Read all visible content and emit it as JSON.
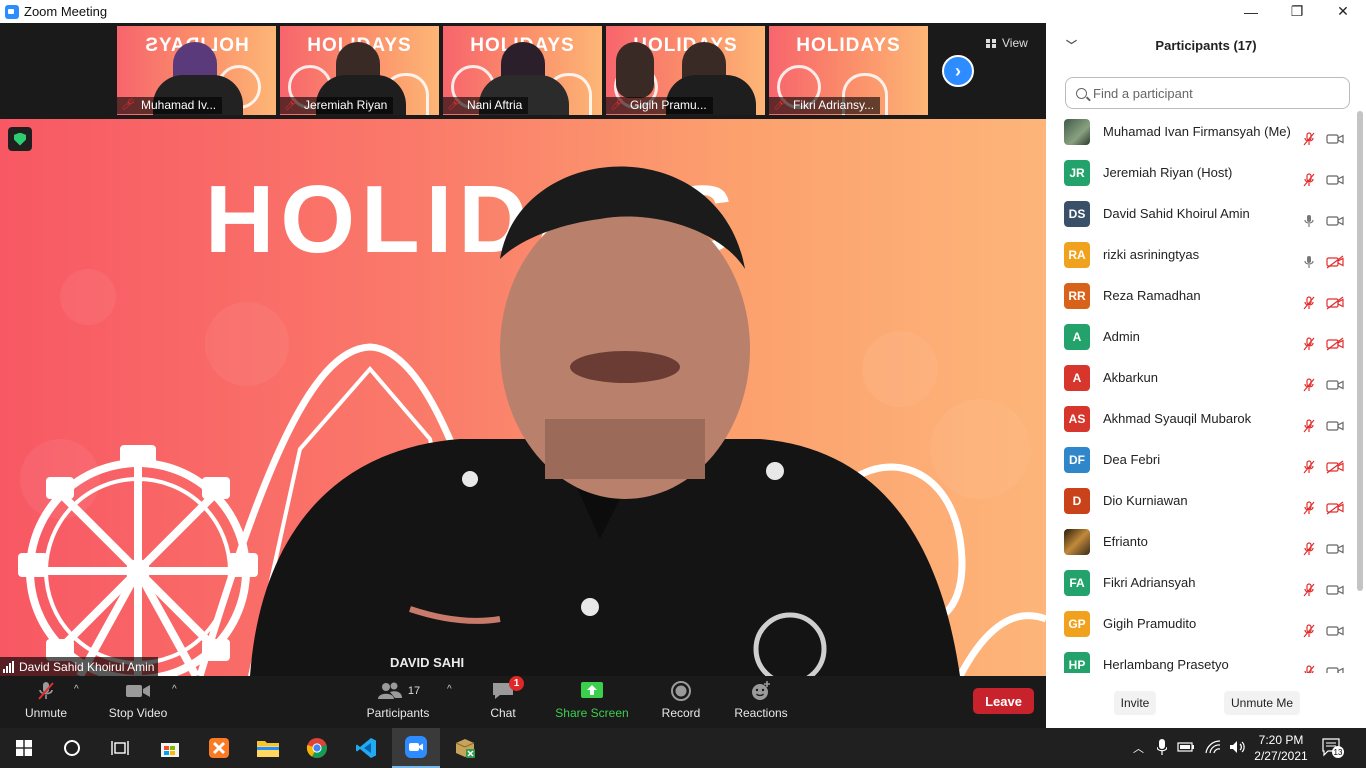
{
  "window": {
    "title": "Zoom Meeting",
    "controls": [
      "—",
      "❐",
      "✕"
    ]
  },
  "thumbnails": [
    {
      "name": "Muhamad Iv...",
      "background_text": "HOLIDAYS",
      "mirrored": true
    },
    {
      "name": "Jeremiah Riyan",
      "background_text": "HOLIDAYS",
      "mirrored": false
    },
    {
      "name": "Nani Aftria",
      "background_text": "HOLIDAYS",
      "mirrored": false
    },
    {
      "name": "Gigih Pramu...",
      "background_text": "HOLIDAYS",
      "mirrored": false
    },
    {
      "name": "Fikri Adriansy...",
      "background_text": "HOLIDAYS",
      "mirrored": false
    }
  ],
  "view_button": {
    "label": "View"
  },
  "main_video": {
    "speaker_name": "David Sahid Khoirul Amin",
    "background_text": "HOLIDAYS",
    "shirt_text": "DAVID SAHI"
  },
  "toolbar": {
    "unmute_label": "Unmute",
    "stop_video_label": "Stop Video",
    "participants_label": "Participants",
    "participants_count": "17",
    "chat_label": "Chat",
    "chat_badge": "1",
    "share_screen_label": "Share Screen",
    "record_label": "Record",
    "reactions_label": "Reactions",
    "leave_label": "Leave"
  },
  "panel": {
    "title": "Participants (17)",
    "search_placeholder": "Find a participant",
    "invite_label": "Invite",
    "unmute_me_label": "Unmute Me"
  },
  "participants": [
    {
      "initials": "",
      "name": "Muhamad Ivan Firmansyah (Me)",
      "avatar_color": "photo",
      "mic": "muted",
      "video": "on"
    },
    {
      "initials": "JR",
      "name": "Jeremiah Riyan (Host)",
      "avatar_color": "#23a36b",
      "mic": "muted",
      "video": "on"
    },
    {
      "initials": "DS",
      "name": "David Sahid Khoirul Amin",
      "avatar_color": "#3a5068",
      "mic": "on",
      "video": "on"
    },
    {
      "initials": "RA",
      "name": "rizki asriningtyas",
      "avatar_color": "#f0a21f",
      "mic": "on",
      "video": "off"
    },
    {
      "initials": "RR",
      "name": "Reza Ramadhan",
      "avatar_color": "#d9621a",
      "mic": "muted",
      "video": "off"
    },
    {
      "initials": "A",
      "name": "Admin",
      "avatar_color": "#23a36b",
      "mic": "muted",
      "video": "off"
    },
    {
      "initials": "A",
      "name": "Akbarkun",
      "avatar_color": "#d6362b",
      "mic": "muted",
      "video": "on"
    },
    {
      "initials": "AS",
      "name": "Akhmad Syauqil Mubarok",
      "avatar_color": "#d6362b",
      "mic": "muted",
      "video": "on"
    },
    {
      "initials": "DF",
      "name": "Dea Febri",
      "avatar_color": "#2f86c9",
      "mic": "muted",
      "video": "off"
    },
    {
      "initials": "D",
      "name": "Dio Kurniawan",
      "avatar_color": "#c9421a",
      "mic": "muted",
      "video": "off"
    },
    {
      "initials": "",
      "name": "Efrianto",
      "avatar_color": "photo2",
      "mic": "muted",
      "video": "on"
    },
    {
      "initials": "FA",
      "name": "Fikri Adriansyah",
      "avatar_color": "#23a36b",
      "mic": "muted",
      "video": "on"
    },
    {
      "initials": "GP",
      "name": "Gigih Pramudito",
      "avatar_color": "#f0a21f",
      "mic": "muted",
      "video": "on"
    },
    {
      "initials": "HP",
      "name": "Herlambang Prasetyo",
      "avatar_color": "#23a36b",
      "mic": "muted",
      "video": "on"
    }
  ],
  "taskbar": {
    "apps": [
      "windows-start",
      "cortana",
      "task-view",
      "store",
      "xampp",
      "file-explorer",
      "chrome",
      "vscode",
      "zoom",
      "package"
    ],
    "time": "7:20 PM",
    "date": "2/27/2021",
    "notification_count": "13"
  },
  "colors": {
    "accent": "#2d8cff",
    "leave": "#c8232c",
    "share": "#3ccf4e",
    "muted_mic": "#e22d2d"
  }
}
